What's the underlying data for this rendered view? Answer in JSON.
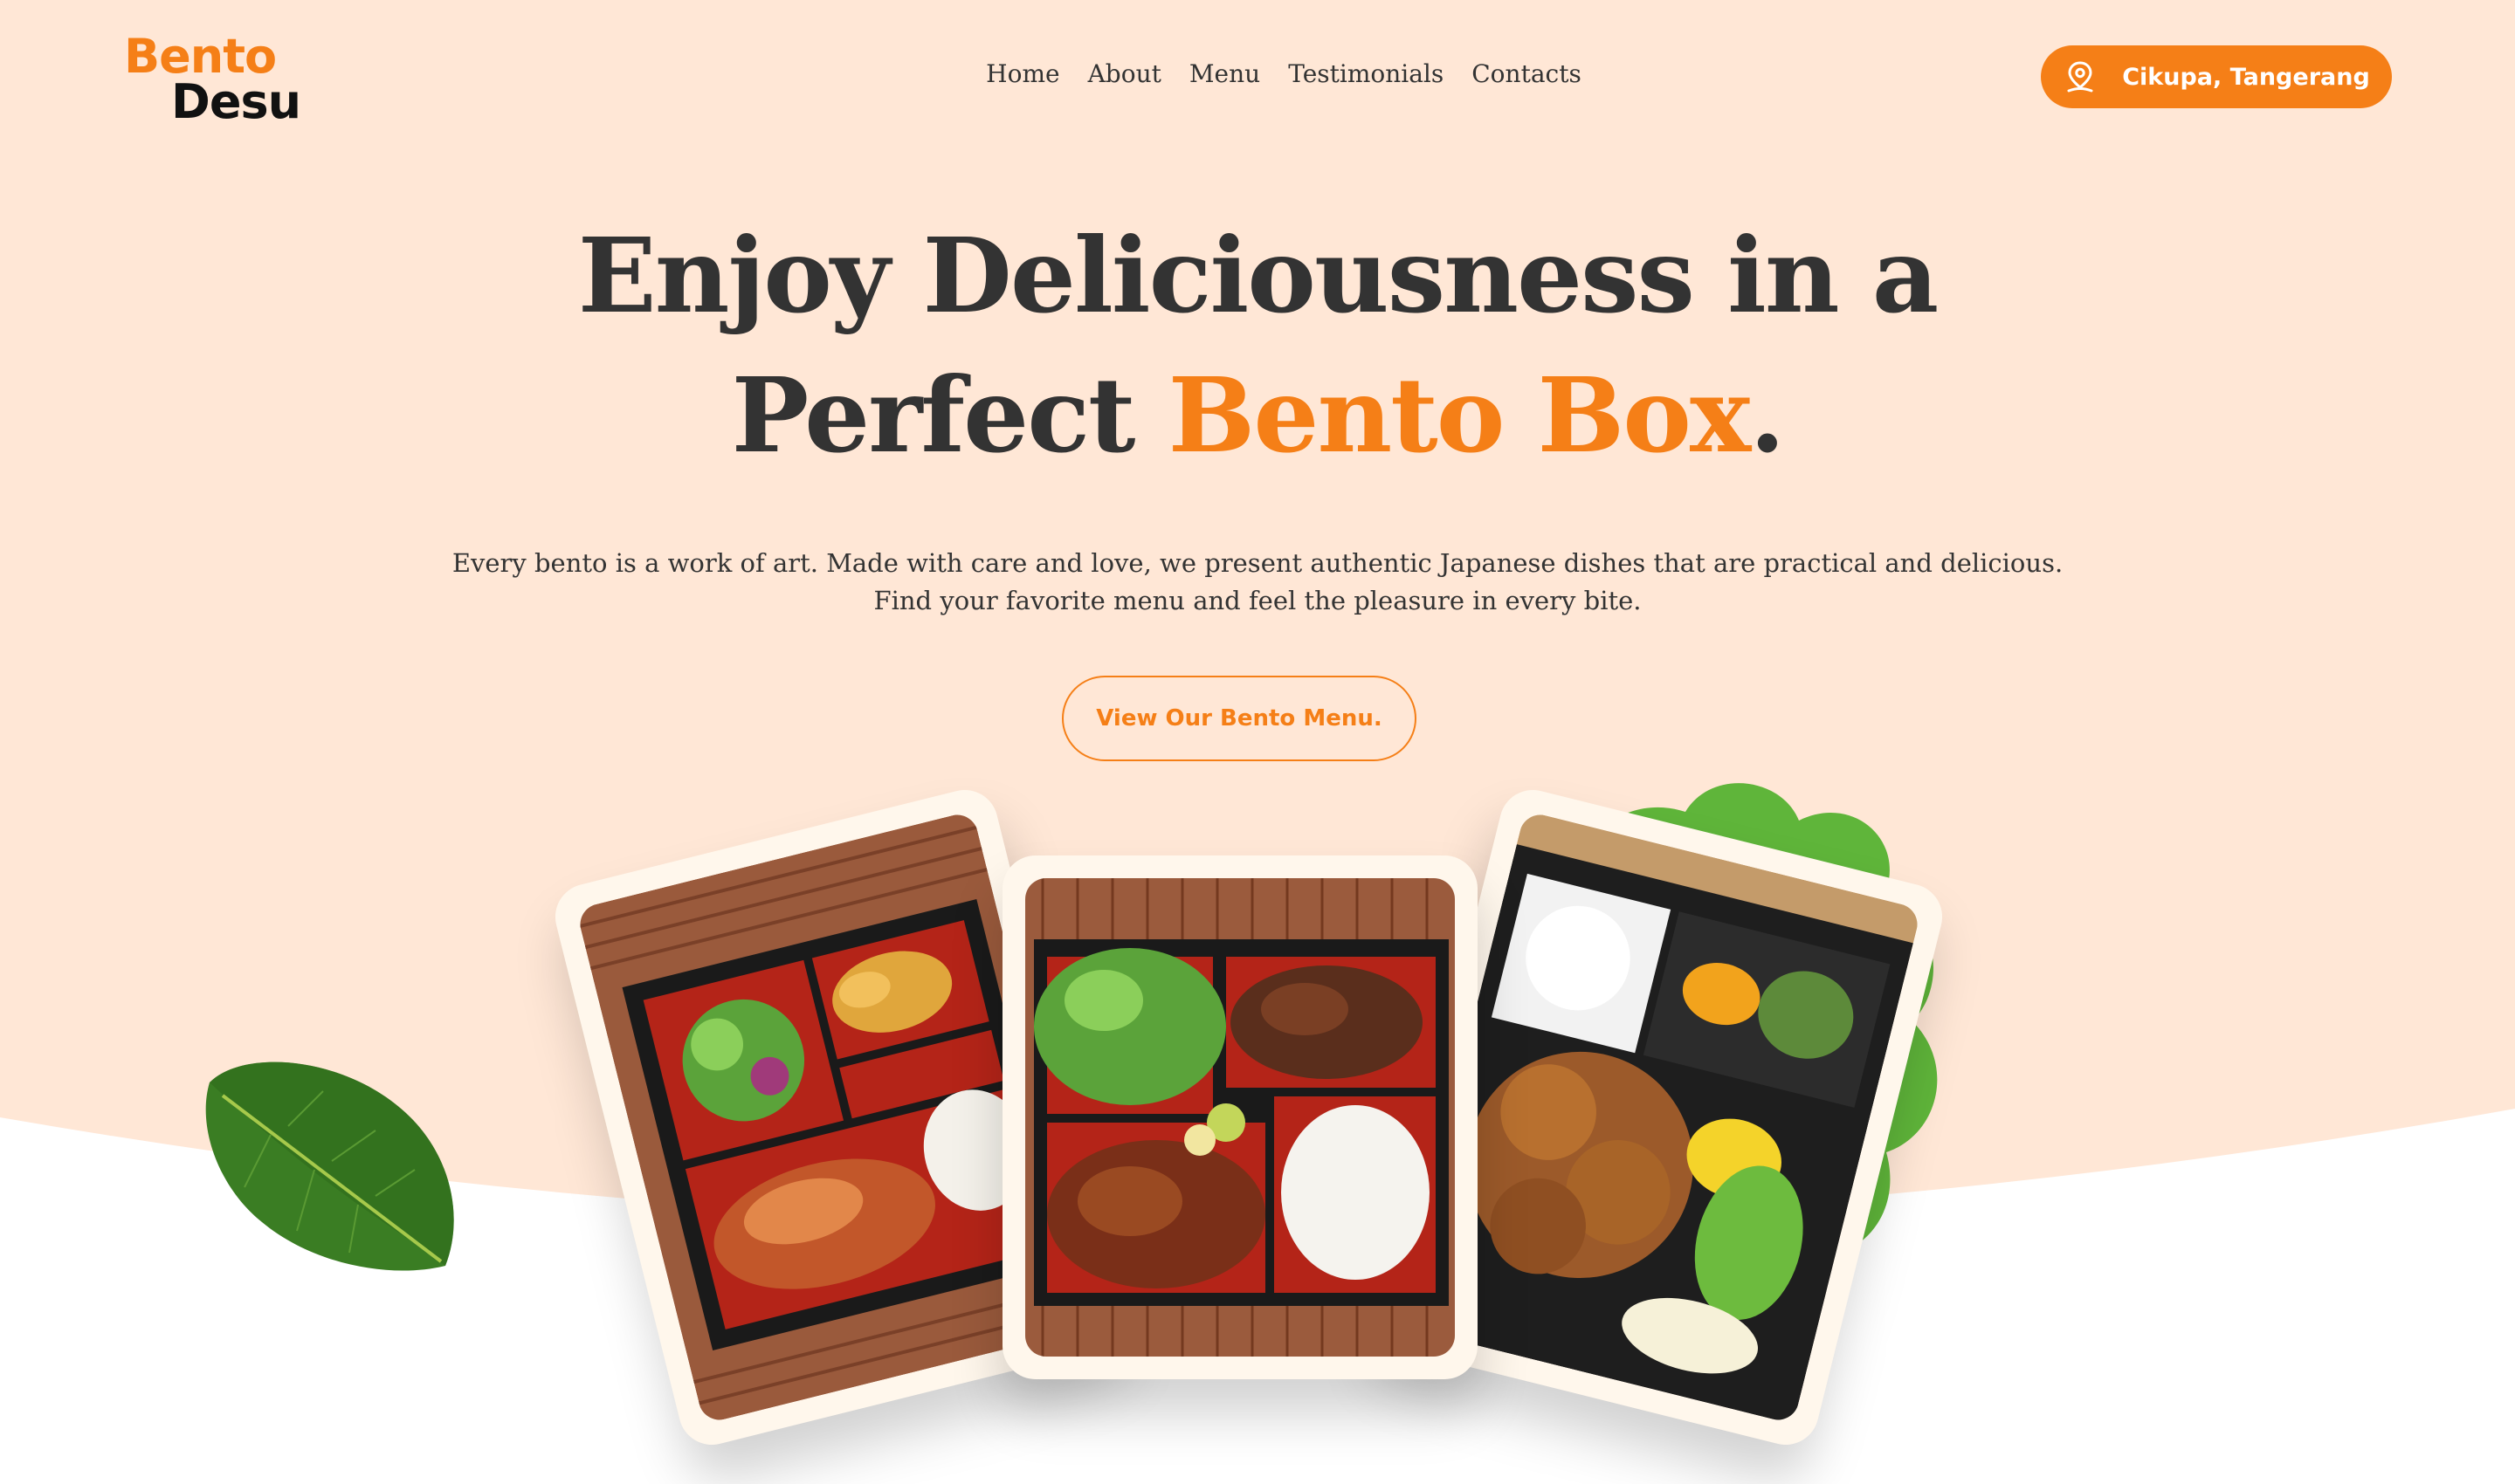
{
  "brand": {
    "line1": "Bento",
    "line2": "Desu"
  },
  "nav": {
    "items": [
      "Home",
      "About",
      "Menu",
      "Testimonials",
      "Contacts"
    ]
  },
  "location_button": {
    "label": "Cikupa, Tangerang",
    "icon": "location-pin-icon"
  },
  "hero": {
    "headline_line1": "Enjoy Deliciousness in a",
    "headline_prefix": "Perfect ",
    "headline_accent": "Bento Box",
    "headline_suffix": ".",
    "description": "Every bento is a work of art. Made with care and love, we present authentic Japanese dishes that are practical and delicious. Find your favorite menu and feel the pleasure in every bite.",
    "cta_label": "View Our Bento Menu."
  },
  "colors": {
    "accent": "#f57f17",
    "hero_background": "#ffe7d6",
    "card_background": "#fff7ec",
    "text_dark": "#333333"
  },
  "images": {
    "left": "bento-box-karaage-gyoza",
    "center": "bento-box-beef-rice",
    "right": "bento-box-fried-chicken",
    "decor_left": "green-leaf",
    "decor_right": "lettuce"
  }
}
